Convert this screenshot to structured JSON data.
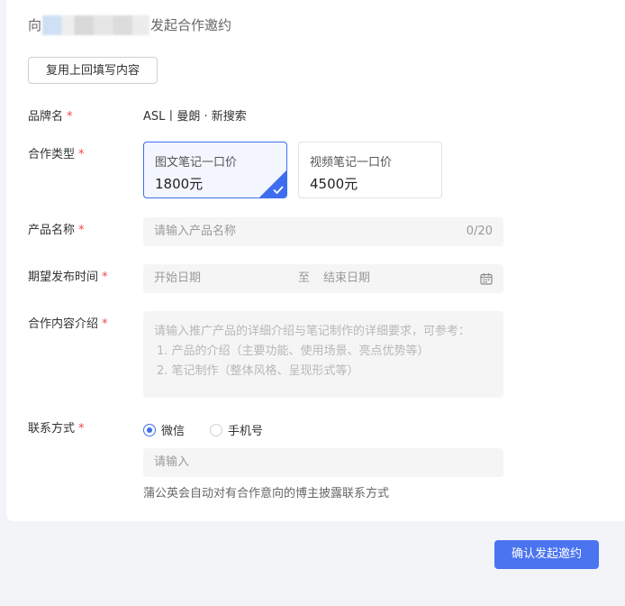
{
  "header": {
    "prefix": "向",
    "suffix": "发起合作邀约"
  },
  "reuse_button": "复用上回填写内容",
  "form": {
    "brand": {
      "label": "品牌名",
      "required_mark": "*",
      "value": "ASL丨曼朗 · 新搜索"
    },
    "cooperation_type": {
      "label": "合作类型",
      "required_mark": "*",
      "options": [
        {
          "title": "图文笔记一口价",
          "price": "1800元",
          "selected": true
        },
        {
          "title": "视频笔记一口价",
          "price": "4500元",
          "selected": false
        }
      ]
    },
    "product_name": {
      "label": "产品名称",
      "required_mark": "*",
      "placeholder": "请输入产品名称",
      "counter": "0/20"
    },
    "publish_time": {
      "label": "期望发布时间",
      "required_mark": "*",
      "start_placeholder": "开始日期",
      "separator": "至",
      "end_placeholder": "结束日期"
    },
    "description": {
      "label": "合作内容介绍",
      "required_mark": "*",
      "placeholder_lines": [
        "请输入推广产品的详细介绍与笔记制作的详细要求，可参考：",
        "1. 产品的介绍（主要功能、使用场景、亮点优势等）",
        "2. 笔记制作（整体风格、呈现形式等）"
      ]
    },
    "contact": {
      "label": "联系方式",
      "required_mark": "*",
      "options": [
        {
          "label": "微信",
          "selected": true
        },
        {
          "label": "手机号",
          "selected": false
        }
      ],
      "input_placeholder": "请输入",
      "hint": "蒲公英会自动对有合作意向的博主披露联系方式"
    }
  },
  "submit_button": "确认发起邀约",
  "colors": {
    "accent": "#3e6ef0",
    "button": "#4a74f0",
    "required": "#f04848",
    "background": "#f3f4f8"
  }
}
